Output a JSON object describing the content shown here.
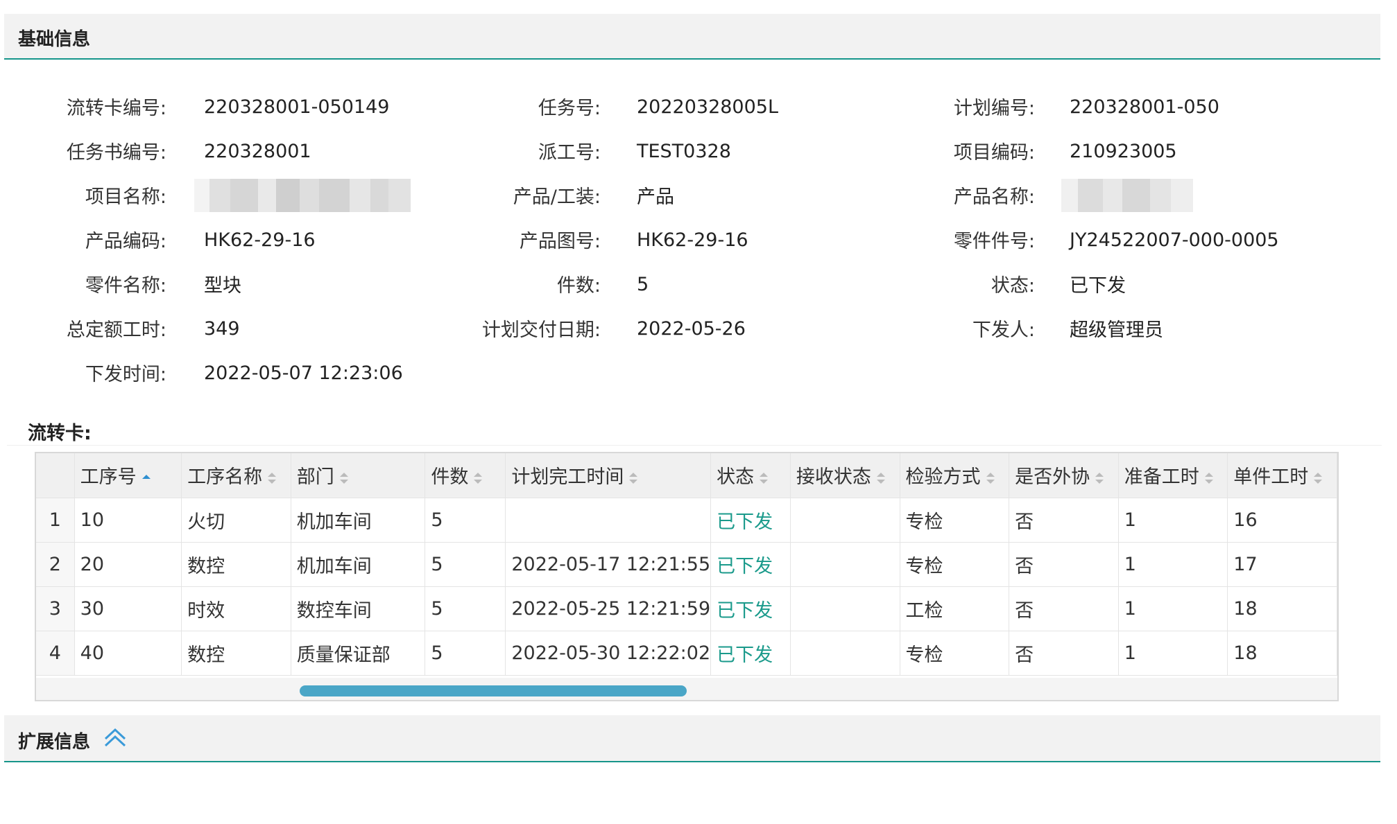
{
  "sections": {
    "basic_title": "基础信息",
    "ext_title": "扩展信息"
  },
  "info": {
    "card_no_label": "流转卡编号:",
    "card_no": "220328001-050149",
    "task_no_label": "任务号:",
    "task_no": "20220328005L",
    "plan_no_label": "计划编号:",
    "plan_no": "220328001-050",
    "taskbook_no_label": "任务书编号:",
    "taskbook_no": "220328001",
    "dispatch_no_label": "派工号:",
    "dispatch_no": "TEST0328",
    "project_code_label": "项目编码:",
    "project_code": "210923005",
    "project_name_label": "项目名称:",
    "product_tool_label": "产品/工装:",
    "product_tool": "产品",
    "product_name_label": "产品名称:",
    "product_code_label": "产品编码:",
    "product_code": "HK62-29-16",
    "product_drawing_label": "产品图号:",
    "product_drawing": "HK62-29-16",
    "part_no_label": "零件件号:",
    "part_no": "JY24522007-000-0005",
    "part_name_label": "零件名称:",
    "part_name": "型块",
    "qty_label": "件数:",
    "qty": "5",
    "status_label": "状态:",
    "status": "已下发",
    "total_hours_label": "总定额工时:",
    "total_hours": "349",
    "delivery_date_label": "计划交付日期:",
    "delivery_date": "2022-05-26",
    "issuer_label": "下发人:",
    "issuer": "超级管理员",
    "issue_time_label": "下发时间:",
    "issue_time": "2022-05-07 12:23:06"
  },
  "flow_card": {
    "title": "流转卡:",
    "columns": [
      "工序号",
      "工序名称",
      "部门",
      "件数",
      "计划完工时间",
      "状态",
      "接收状态",
      "检验方式",
      "是否外协",
      "准备工时",
      "单件工时"
    ],
    "rows": [
      [
        "1",
        "10",
        "火切",
        "机加车间",
        "5",
        "",
        "已下发",
        "",
        "专检",
        "否",
        "1",
        "16"
      ],
      [
        "2",
        "20",
        "数控",
        "机加车间",
        "5",
        "2022-05-17 12:21:55",
        "已下发",
        "",
        "专检",
        "否",
        "1",
        "17"
      ],
      [
        "3",
        "30",
        "时效",
        "数控车间",
        "5",
        "2022-05-25 12:21:59",
        "已下发",
        "",
        "工检",
        "否",
        "1",
        "18"
      ],
      [
        "4",
        "40",
        "数控",
        "质量保证部",
        "5",
        "2022-05-30 12:22:02",
        "已下发",
        "",
        "专检",
        "否",
        "1",
        "18"
      ]
    ],
    "sorted_column": "工序号",
    "sort_direction": "asc"
  },
  "colors": {
    "accent": "#16958a",
    "status_green": "#1a9a8b",
    "scrollbar": "#4aa6c7"
  }
}
